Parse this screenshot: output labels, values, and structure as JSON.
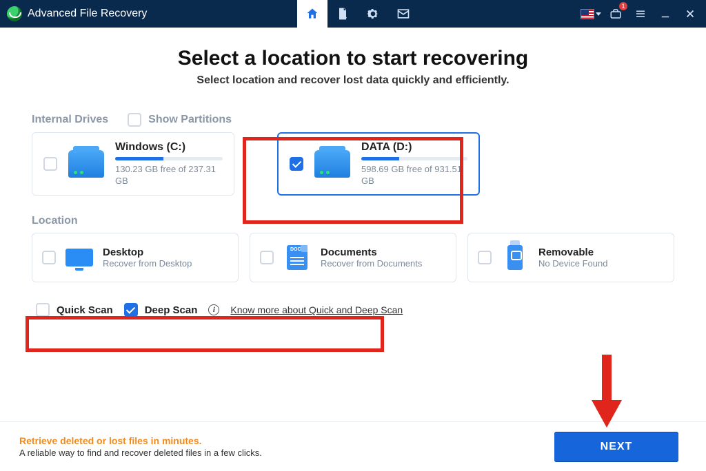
{
  "app": {
    "title": "Advanced File Recovery"
  },
  "titlebar": {
    "tabs": {
      "home": "home-icon",
      "search": "file-search-icon",
      "settings": "gear-icon",
      "mail": "mail-icon"
    },
    "badge": "1"
  },
  "heading": "Select a location to start recovering",
  "subheading": "Select location and recover lost data quickly and efficiently.",
  "sections": {
    "drives_label": "Internal Drives",
    "show_partitions": "Show Partitions",
    "location_label": "Location"
  },
  "drives": [
    {
      "name": "Windows (C:)",
      "meta_line1": "130.23 GB free of 237.31",
      "meta_line2": "GB",
      "fill_pct": 45,
      "selected": false
    },
    {
      "name": "DATA (D:)",
      "meta_line1": "598.69 GB free of 931.51",
      "meta_line2": "GB",
      "fill_pct": 36,
      "selected": true
    }
  ],
  "locations": [
    {
      "name": "Desktop",
      "sub": "Recover from Desktop"
    },
    {
      "name": "Documents",
      "sub": "Recover from Documents"
    },
    {
      "name": "Removable",
      "sub": "No Device Found"
    }
  ],
  "scan": {
    "quick_label": "Quick Scan",
    "quick_checked": false,
    "deep_label": "Deep Scan",
    "deep_checked": true,
    "link": "Know more about Quick and Deep Scan"
  },
  "footer": {
    "line1": "Retrieve deleted or lost files in minutes.",
    "line2": "A reliable way to find and recover deleted files in a few clicks.",
    "next": "NEXT"
  },
  "doc_tag": "DOC"
}
